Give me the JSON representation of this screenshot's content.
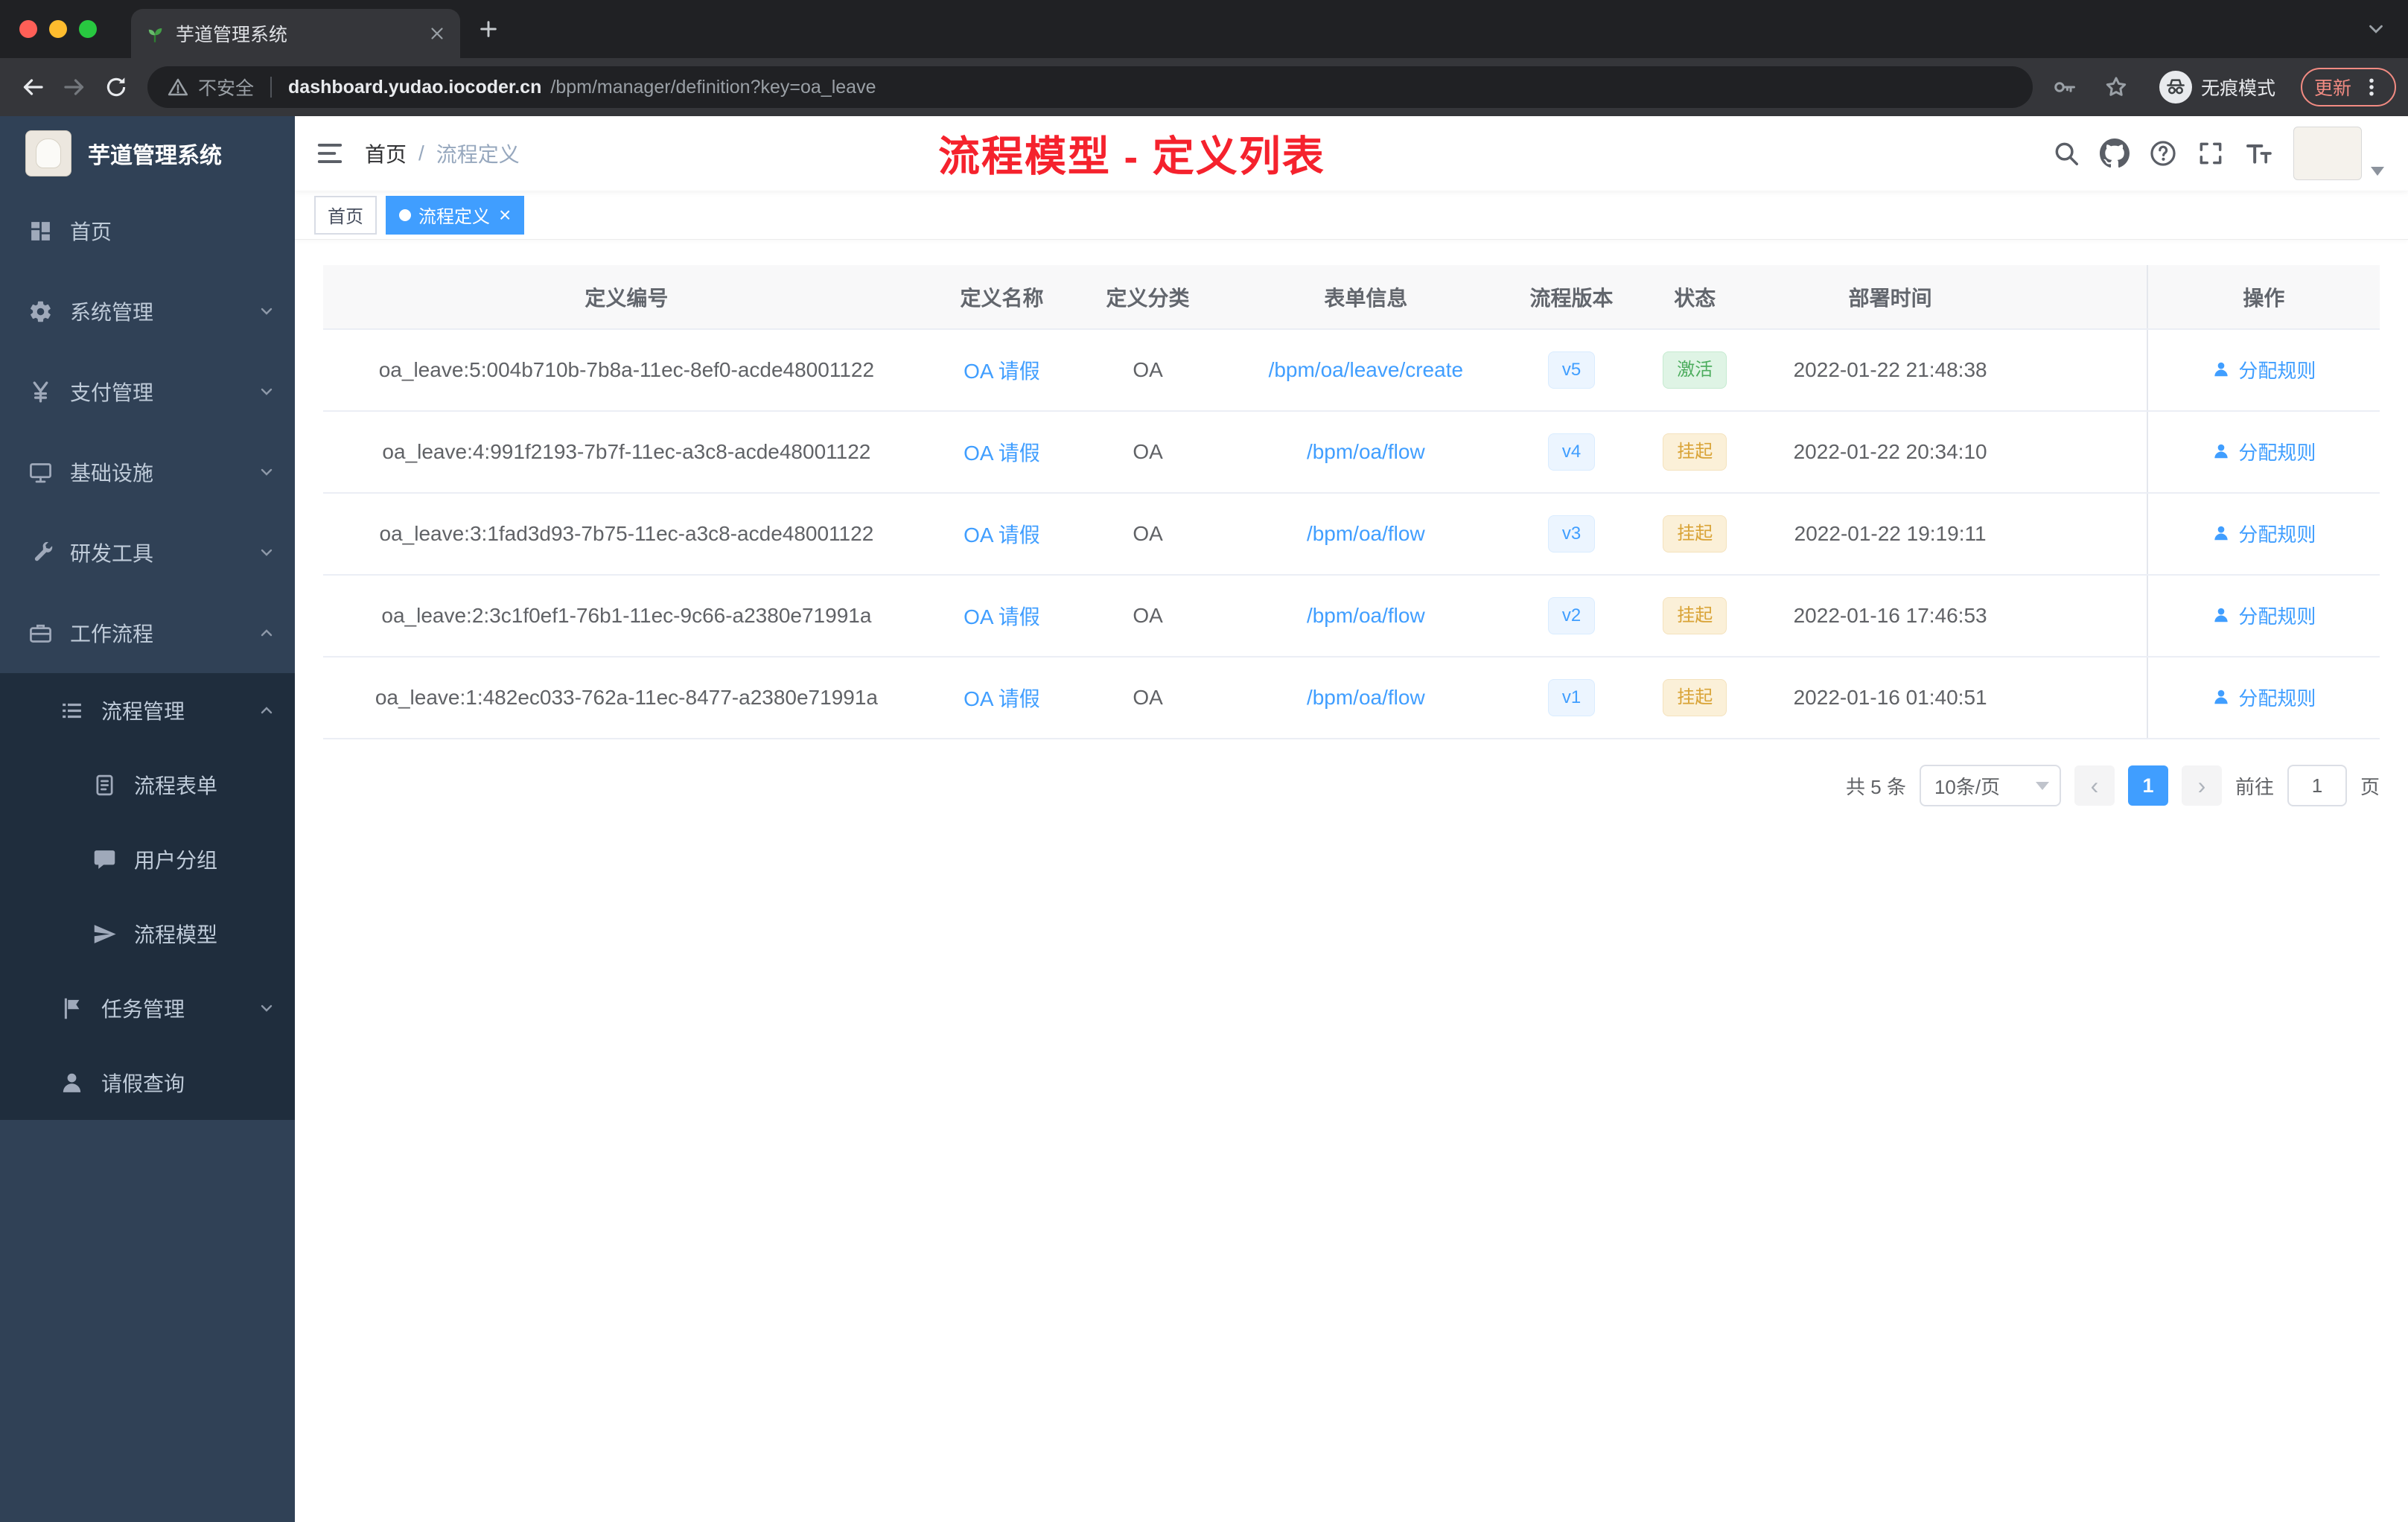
{
  "browser": {
    "tab": {
      "title": "芋道管理系统"
    },
    "address": {
      "security_label": "不安全",
      "domain": "dashboard.yudao.iocoder.cn",
      "path": "/bpm/manager/definition?key=oa_leave"
    },
    "incognito_label": "无痕模式",
    "update_label": "更新"
  },
  "sidebar": {
    "logo_title": "芋道管理系统",
    "items": [
      {
        "label": "首页",
        "icon": "dashboard-icon"
      },
      {
        "label": "系统管理",
        "icon": "gear-icon",
        "arrow": "down"
      },
      {
        "label": "支付管理",
        "icon": "payment-icon",
        "arrow": "down"
      },
      {
        "label": "基础设施",
        "icon": "infrastructure-icon",
        "arrow": "down"
      },
      {
        "label": "研发工具",
        "icon": "devtools-icon",
        "arrow": "down"
      },
      {
        "label": "工作流程",
        "icon": "workflow-icon",
        "arrow": "up"
      },
      {
        "label": "流程管理",
        "icon": "process-manage-icon",
        "arrow": "up"
      },
      {
        "label": "流程表单",
        "icon": "process-form-icon"
      },
      {
        "label": "用户分组",
        "icon": "user-group-icon"
      },
      {
        "label": "流程模型",
        "icon": "process-model-icon"
      },
      {
        "label": "任务管理",
        "icon": "task-manage-icon",
        "arrow": "down"
      },
      {
        "label": "请假查询",
        "icon": "leave-query-icon"
      }
    ]
  },
  "navbar": {
    "breadcrumb": {
      "root": "首页",
      "separator": "/",
      "current": "流程定义"
    },
    "annotation": "流程模型 - 定义列表"
  },
  "tags_view": {
    "tags": [
      {
        "label": "首页",
        "active": false
      },
      {
        "label": "流程定义",
        "active": true
      }
    ]
  },
  "table": {
    "columns": [
      "定义编号",
      "定义名称",
      "定义分类",
      "表单信息",
      "流程版本",
      "状态",
      "部署时间",
      "操作"
    ],
    "action_label": "分配规则",
    "rows": [
      {
        "id": "oa_leave:5:004b710b-7b8a-11ec-8ef0-acde48001122",
        "name": "OA 请假",
        "category": "OA",
        "form": "/bpm/oa/leave/create",
        "version": "v5",
        "status": "激活",
        "status_type": "success",
        "deploy_time": "2022-01-22 21:48:38"
      },
      {
        "id": "oa_leave:4:991f2193-7b7f-11ec-a3c8-acde48001122",
        "name": "OA 请假",
        "category": "OA",
        "form": "/bpm/oa/flow",
        "version": "v4",
        "status": "挂起",
        "status_type": "warning",
        "deploy_time": "2022-01-22 20:34:10"
      },
      {
        "id": "oa_leave:3:1fad3d93-7b75-11ec-a3c8-acde48001122",
        "name": "OA 请假",
        "category": "OA",
        "form": "/bpm/oa/flow",
        "version": "v3",
        "status": "挂起",
        "status_type": "warning",
        "deploy_time": "2022-01-22 19:19:11"
      },
      {
        "id": "oa_leave:2:3c1f0ef1-76b1-11ec-9c66-a2380e71991a",
        "name": "OA 请假",
        "category": "OA",
        "form": "/bpm/oa/flow",
        "version": "v2",
        "status": "挂起",
        "status_type": "warning",
        "deploy_time": "2022-01-16 17:46:53"
      },
      {
        "id": "oa_leave:1:482ec033-762a-11ec-8477-a2380e71991a",
        "name": "OA 请假",
        "category": "OA",
        "form": "/bpm/oa/flow",
        "version": "v1",
        "status": "挂起",
        "status_type": "warning",
        "deploy_time": "2022-01-16 01:40:51"
      }
    ]
  },
  "pagination": {
    "total_label": "共 5 条",
    "page_size": "10条/页",
    "current_page": "1",
    "goto_label": "前往",
    "goto_value": "1",
    "page_unit": "页"
  },
  "colors": {
    "accent": "#409eff",
    "annotation_red": "#f5222d",
    "status_active_green": "#67c23a",
    "status_suspend_orange": "#e6a23c",
    "sidebar_bg": "#304156",
    "submenu_bg": "#1f2d3d"
  }
}
